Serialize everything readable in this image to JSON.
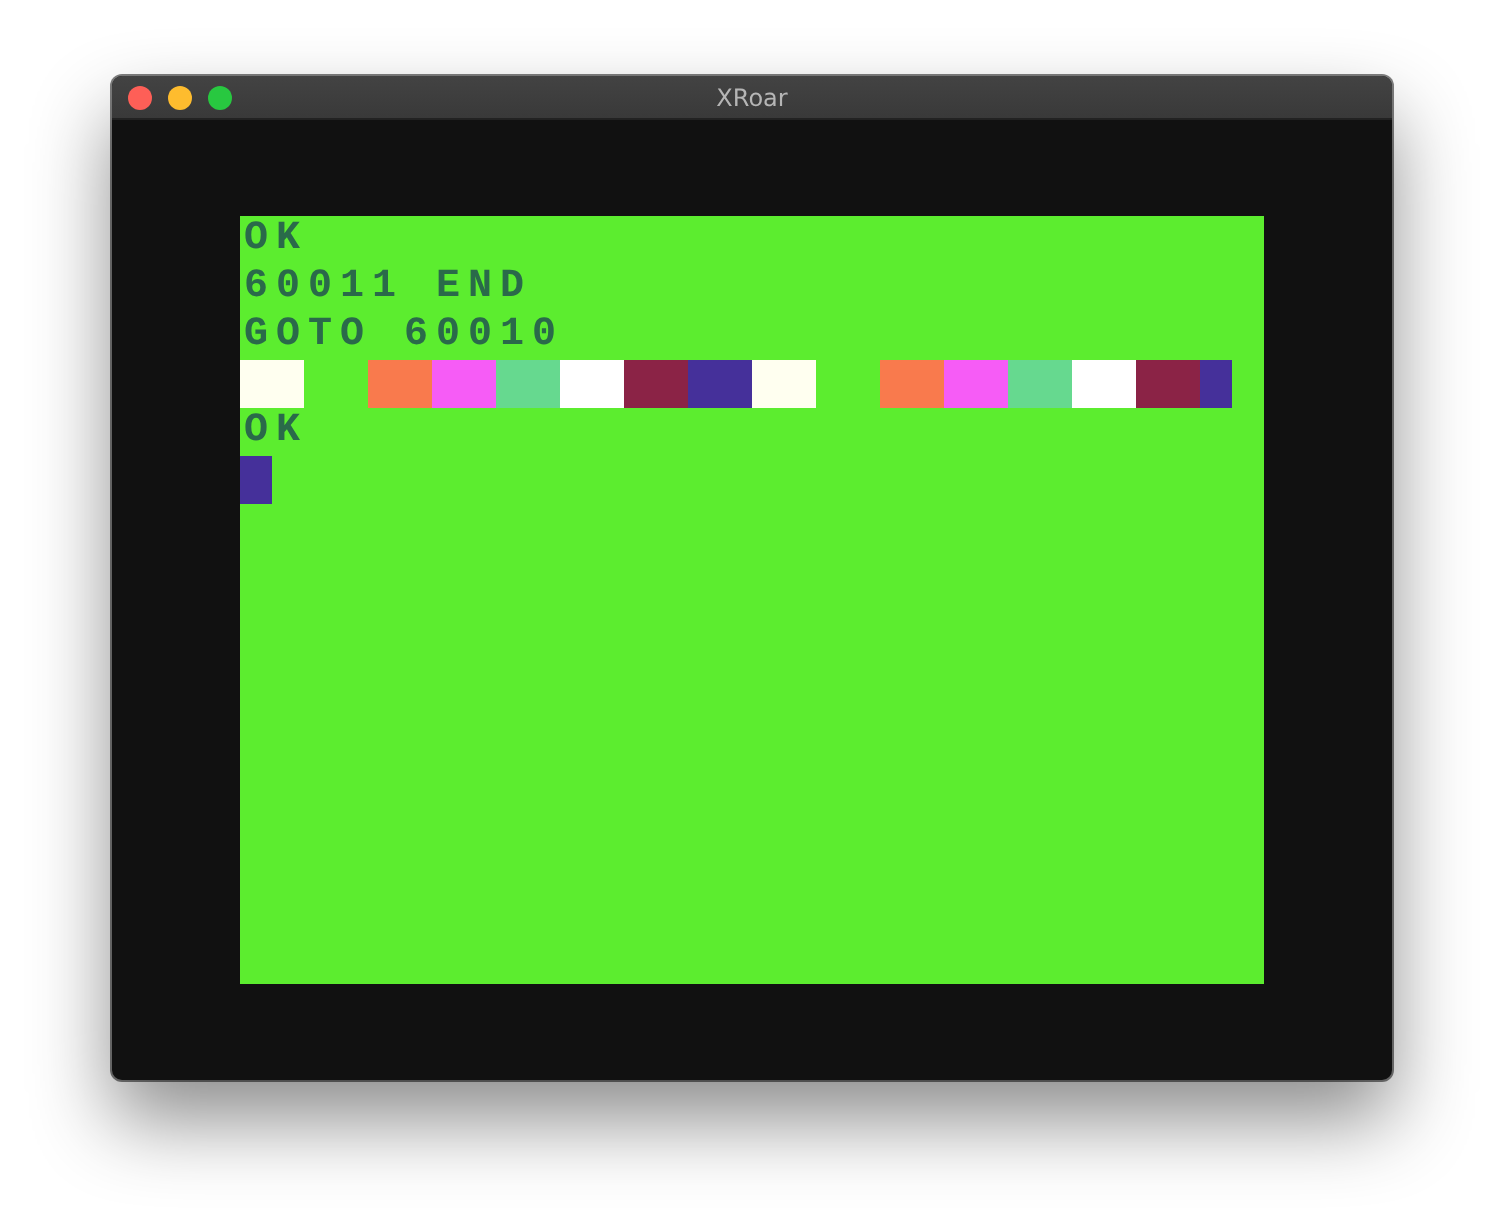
{
  "window": {
    "title": "XRoar"
  },
  "screen": {
    "lines": [
      {
        "kind": "text",
        "text": "OK"
      },
      {
        "kind": "text",
        "text": "60011 END"
      },
      {
        "kind": "text",
        "text": "GOTO 60010"
      },
      {
        "kind": "blocks",
        "blocks": [
          {
            "kind": "double",
            "color": "#fffff0"
          },
          {
            "kind": "gap"
          },
          {
            "kind": "double",
            "color": "#f97a4d"
          },
          {
            "kind": "double",
            "color": "#f65cf6"
          },
          {
            "kind": "double",
            "color": "#66d98f"
          },
          {
            "kind": "double",
            "color": "#ffffff"
          },
          {
            "kind": "double",
            "color": "#8b2346"
          },
          {
            "kind": "double",
            "color": "#45309a"
          },
          {
            "kind": "double",
            "color": "#fffff0"
          },
          {
            "kind": "gap"
          },
          {
            "kind": "double",
            "color": "#f97a4d"
          },
          {
            "kind": "double",
            "color": "#f65cf6"
          },
          {
            "kind": "double",
            "color": "#66d98f"
          },
          {
            "kind": "double",
            "color": "#ffffff"
          },
          {
            "kind": "double",
            "color": "#8b2346"
          },
          {
            "kind": "single",
            "color": "#45309a"
          }
        ]
      },
      {
        "kind": "text",
        "text": "OK"
      },
      {
        "kind": "cursor",
        "color": "#45309a"
      }
    ]
  }
}
